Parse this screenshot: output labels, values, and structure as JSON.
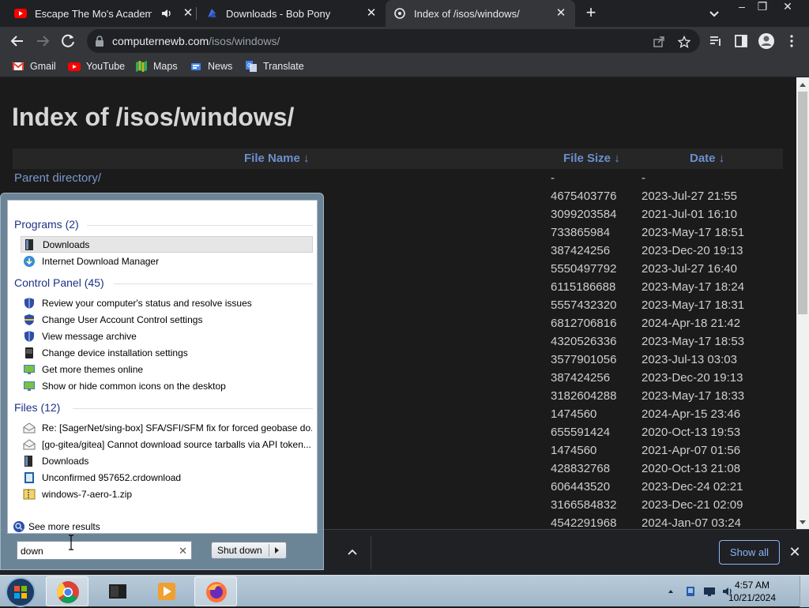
{
  "browser": {
    "tabs": [
      {
        "title": "Escape The Mo's Academy -",
        "favicon": "youtube-icon",
        "audio": true
      },
      {
        "title": "Downloads - Bob Pony",
        "favicon": "bobpony-icon"
      },
      {
        "title": "Index of /isos/windows/",
        "favicon": "site-icon",
        "active": true
      }
    ],
    "url_host": "computernewb.com",
    "url_path": "/isos/windows/",
    "bookmarks": [
      {
        "label": "Gmail",
        "icon": "gmail-icon"
      },
      {
        "label": "YouTube",
        "icon": "youtube-icon"
      },
      {
        "label": "Maps",
        "icon": "maps-icon"
      },
      {
        "label": "News",
        "icon": "news-icon"
      },
      {
        "label": "Translate",
        "icon": "translate-icon"
      }
    ]
  },
  "page": {
    "title": "Index of /isos/windows/",
    "columns": {
      "name": "File Name  ↓",
      "size": "File Size  ↓",
      "date": "Date  ↓"
    },
    "parent": {
      "name": "Parent directory/",
      "size": "-",
      "date": "-"
    },
    "rows": [
      {
        "size": "4675403776",
        "date": "2023-Jul-27 21:55"
      },
      {
        "size": "3099203584",
        "date": "2021-Jul-01 16:10"
      },
      {
        "size": "733865984",
        "date": "2023-May-17 18:51"
      },
      {
        "size": "387424256",
        "date": "2023-Dec-20 19:13"
      },
      {
        "size": "5550497792",
        "date": "2023-Jul-27 16:40"
      },
      {
        "size": "6115186688",
        "date": "2023-May-17 18:24"
      },
      {
        "size": "5557432320",
        "date": "2023-May-17 18:31"
      },
      {
        "size": "6812706816",
        "date": "2024-Apr-18 21:42"
      },
      {
        "size": "4320526336",
        "date": "2023-May-17 18:53"
      },
      {
        "size": "3577901056",
        "date": "2023-Jul-13 03:03"
      },
      {
        "size": "387424256",
        "date": "2023-Dec-20 19:13"
      },
      {
        "size": "3182604288",
        "date": "2023-May-17 18:33"
      },
      {
        "size": "1474560",
        "date": "2024-Apr-15 23:46"
      },
      {
        "size": "655591424",
        "date": "2020-Oct-13 19:53"
      },
      {
        "size": "1474560",
        "date": "2021-Apr-07 01:56"
      },
      {
        "size": "428832768",
        "date": "2020-Oct-13 21:08"
      },
      {
        "size": "606443520",
        "date": "2023-Dec-24 02:21"
      },
      {
        "size": "3166584832",
        "date": "2023-Dec-21 02:09"
      },
      {
        "size": "4542291968",
        "date": "2024-Jan-07 03:24"
      }
    ]
  },
  "shelf": {
    "show_all": "Show all"
  },
  "start_menu": {
    "groups": {
      "programs": "Programs (2)",
      "control_panel": "Control Panel (45)",
      "files": "Files (12)"
    },
    "programs": [
      {
        "label": "Downloads",
        "icon": "downloads-folder-icon"
      },
      {
        "label": "Internet Download Manager",
        "icon": "idm-icon"
      }
    ],
    "control_panel": [
      {
        "label": "Review your computer's status and resolve issues",
        "icon": "action-center-icon"
      },
      {
        "label": "Change User Account Control settings",
        "icon": "uac-shield-icon"
      },
      {
        "label": "View message archive",
        "icon": "action-center-icon"
      },
      {
        "label": "Change device installation settings",
        "icon": "device-icon"
      },
      {
        "label": "Get more themes online",
        "icon": "personalization-icon"
      },
      {
        "label": "Show or hide common icons on the desktop",
        "icon": "personalization-icon"
      }
    ],
    "files": [
      {
        "label": "Re: [SagerNet/sing-box] SFA/SFI/SFM fix for forced geobase do...",
        "icon": "mail-icon"
      },
      {
        "label": "[go-gitea/gitea] Cannot download source tarballs via API token...",
        "icon": "mail-icon"
      },
      {
        "label": "Downloads",
        "icon": "downloads-folder-icon"
      },
      {
        "label": "Unconfirmed 957652.crdownload",
        "icon": "file-icon"
      },
      {
        "label": "windows-7-aero-1.zip",
        "icon": "zip-icon"
      }
    ],
    "see_more": "See more results",
    "search_value": "down",
    "shutdown_label": "Shut down"
  },
  "taskbar": {
    "clock_time": "4:57 AM",
    "clock_date": "10/21/2024"
  }
}
